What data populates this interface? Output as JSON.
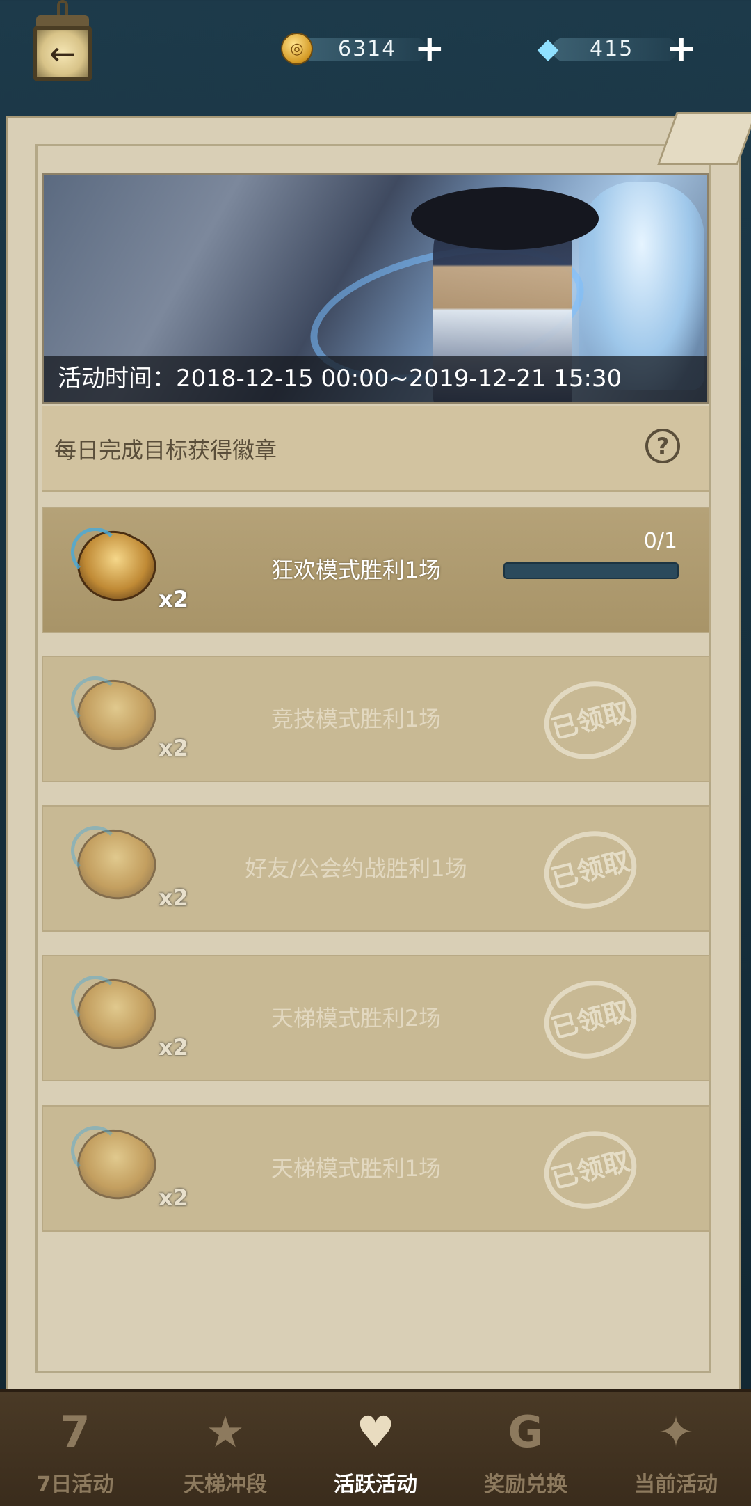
{
  "header": {
    "back_icon": "back-arrow-icon",
    "coins": {
      "icon": "gold-coin-icon",
      "value": "6314",
      "add_label": "+"
    },
    "gems": {
      "icon": "diamond-icon",
      "value": "415",
      "add_label": "+"
    }
  },
  "banner": {
    "time_label": "活动时间：2018-12-15 00:00~2019-12-21 15:30"
  },
  "subheader": {
    "text": "每日完成目标获得徽章",
    "help_label": "?"
  },
  "tasks": [
    {
      "label": "狂欢模式胜利1场",
      "reward_qty": "x2",
      "progress": "0/1",
      "progress_fraction": 0,
      "status": "in_progress"
    },
    {
      "label": "竞技模式胜利1场",
      "reward_qty": "x2",
      "stamp": "已领取",
      "status": "claimed"
    },
    {
      "label": "好友/公会约战胜利1场",
      "reward_qty": "x2",
      "stamp": "已领取",
      "status": "claimed"
    },
    {
      "label": "天梯模式胜利2场",
      "reward_qty": "x2",
      "stamp": "已领取",
      "status": "claimed"
    },
    {
      "label": "天梯模式胜利1场",
      "reward_qty": "x2",
      "stamp": "已领取",
      "status": "claimed"
    }
  ],
  "nav": [
    {
      "label": "7日活动",
      "icon": "seven-day-icon",
      "glyph": "7",
      "active": false
    },
    {
      "label": "天梯冲段",
      "icon": "ladder-medal-icon",
      "glyph": "★",
      "active": false
    },
    {
      "label": "活跃活动",
      "icon": "trophy-icon",
      "glyph": "♥",
      "active": true
    },
    {
      "label": "奖励兑换",
      "icon": "exchange-g-icon",
      "glyph": "G",
      "active": false
    },
    {
      "label": "当前活动",
      "icon": "party-horn-icon",
      "glyph": "✦",
      "active": false
    }
  ],
  "colors": {
    "panel": "#d9cfb6",
    "task_bg": "#c8b994",
    "progress_bar": "#2b4a5c",
    "nav_bg": "#3a2c1c"
  }
}
